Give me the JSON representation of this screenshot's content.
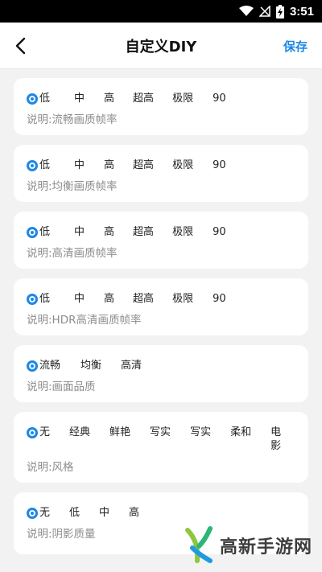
{
  "status": {
    "time": "3:51"
  },
  "header": {
    "title": "自定义DIY",
    "save_label": "保存"
  },
  "cards": [
    {
      "options": [
        "低",
        "中",
        "高",
        "超高",
        "极限",
        "90"
      ],
      "description": "说明:流畅画质帧率"
    },
    {
      "options": [
        "低",
        "中",
        "高",
        "超高",
        "极限",
        "90"
      ],
      "description": "说明:均衡画质帧率"
    },
    {
      "options": [
        "低",
        "中",
        "高",
        "超高",
        "极限",
        "90"
      ],
      "description": "说明:高清画质帧率"
    },
    {
      "options": [
        "低",
        "中",
        "高",
        "超高",
        "极限",
        "90"
      ],
      "description": "说明:HDR高清画质帧率"
    },
    {
      "options": [
        "流畅",
        "均衡",
        "高清"
      ],
      "description": "说明:画面品质"
    },
    {
      "options": [
        "无",
        "经典",
        "鲜艳",
        "写实",
        "写实",
        "柔和",
        "电影"
      ],
      "description": "说明:风格"
    },
    {
      "options": [
        "无",
        "低",
        "中",
        "高"
      ],
      "description": "说明:阴影质量"
    }
  ],
  "watermark": {
    "text": "高新手游网"
  },
  "colors": {
    "accent": "#1e88e5",
    "background": "#f2f2f2"
  }
}
